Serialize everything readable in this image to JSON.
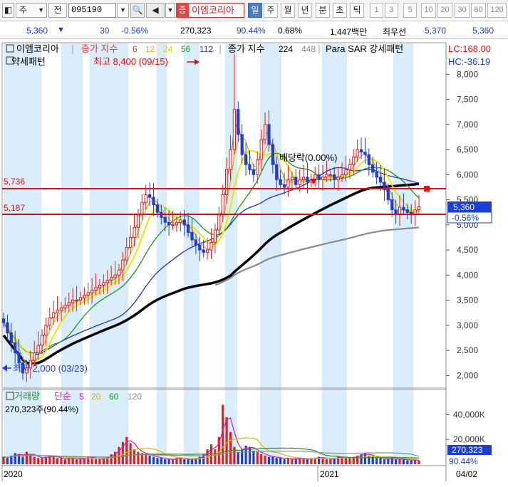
{
  "toolbar": {
    "menu_label": "주",
    "prev_label": "전",
    "code": "095190",
    "jeung_badge": "증",
    "stock_name": "이엠코리아",
    "periods": [
      "일",
      "주",
      "월",
      "년",
      "분",
      "초",
      "틱"
    ],
    "active_period": "일",
    "minute_options": [
      "1",
      "3",
      "5",
      "10",
      "20",
      "30",
      "60",
      "120"
    ]
  },
  "quote": {
    "price": "5,360",
    "change": "30",
    "change_pct": "-0.56%",
    "volume": "270,323",
    "volume_ratio": "90.44%",
    "turnover": "0.68%",
    "trade_value": "1,447백만",
    "ask_label": "최우선",
    "ask": "5,370",
    "bid": "5,360"
  },
  "price_panel": {
    "legend": {
      "name": "이엠코리아",
      "ma_title": "종가 지수",
      "ma_periods": [
        "6",
        "12",
        "24",
        "56",
        "112"
      ],
      "ma_colors": [
        "#e03a3a",
        "#e0b400",
        "#e8e800",
        "#1a9a1a",
        "#2a2ad8"
      ],
      "ma2_title": "종가 지수",
      "ma2_periods": [
        "224",
        "448"
      ],
      "ma2_colors": [
        "#000000",
        "#8a8a8a"
      ],
      "sar_title": "Para SAR 강세패턴",
      "sar_sub": "약세패턴"
    },
    "lc": "LC:168.00",
    "hc": "HC:-36.19",
    "high_annotation": "최고 8,400 (09/15)",
    "low_annotation": "최저 2,000 (03/23)",
    "dividend_label": "배당락(0.00%)",
    "hline_upper": "5,736",
    "hline_lower": "5,187",
    "current_price_tag": "5,360",
    "current_pct_tag": "-0.56%",
    "y_ticks": [
      "8,000",
      "7,500",
      "7,000",
      "6,500",
      "6,000",
      "5,500",
      "5,000",
      "4,500",
      "4,000",
      "3,500",
      "3,000",
      "2,500",
      "2,000"
    ]
  },
  "volume_panel": {
    "legend_title": "거래량",
    "ma_title": "단순",
    "ma_periods": [
      "5",
      "20",
      "60",
      "120"
    ],
    "ma_colors": [
      "#c81ec8",
      "#e0b400",
      "#1a9a1a",
      "#8a8a8a"
    ],
    "sub_label": "270,323주(90.44%)",
    "y_ticks": [
      "40,000K",
      "20,000K"
    ],
    "current_tag": "270,323",
    "current_pct": "90.44%"
  },
  "x_axis": {
    "labels": [
      "2020",
      "2021"
    ],
    "end_date": "04/02"
  },
  "colors": {
    "up": "#e02020",
    "down": "#1a3fd8",
    "stripe": "#d9ecfa",
    "hline": "#e01010",
    "axis_bg": "#ffffff"
  },
  "chart_data": {
    "type": "candlestick",
    "x_range": [
      "2020-01",
      "2021-04-02"
    ],
    "y_range": [
      1750,
      8600
    ],
    "close_series": [
      3050,
      2850,
      2650,
      2450,
      2250,
      2050,
      2150,
      2300,
      2450,
      2600,
      2800,
      3000,
      3150,
      3250,
      3300,
      3350,
      3400,
      3450,
      3500,
      3500,
      3550,
      3600,
      3650,
      3700,
      3750,
      3800,
      3850,
      3900,
      3950,
      4000,
      4100,
      4300,
      4550,
      4750,
      4950,
      5200,
      5450,
      5600,
      5550,
      5400,
      5250,
      5150,
      5050,
      5000,
      5000,
      5050,
      5100,
      5000,
      4850,
      4700,
      4600,
      4500,
      4450,
      4500,
      4650,
      4900,
      5200,
      5600,
      6100,
      6500,
      7300,
      6800,
      6400,
      6200,
      6100,
      6000,
      6300,
      6700,
      7000,
      6600,
      6200,
      5900,
      5800,
      5750,
      5900,
      5950,
      5800,
      5900,
      5950,
      5850,
      5900,
      6000,
      5900,
      5950,
      6000,
      6000,
      5900,
      5950,
      6000,
      6100,
      6200,
      6350,
      6500,
      6450,
      6400,
      6200,
      6050,
      5950,
      5850,
      5700,
      5500,
      5300,
      5200,
      5350,
      5300,
      5250,
      5200,
      5300,
      5360
    ],
    "volume_series": [
      6,
      5,
      7,
      9,
      8,
      6,
      10,
      8,
      6,
      5,
      5,
      6,
      7,
      6,
      5,
      5,
      4,
      5,
      5,
      4,
      4,
      5,
      6,
      5,
      4,
      4,
      5,
      6,
      8,
      10,
      14,
      18,
      22,
      17,
      12,
      10,
      9,
      8,
      7,
      6,
      5,
      5,
      4,
      4,
      4,
      5,
      5,
      4,
      4,
      4,
      5,
      6,
      8,
      12,
      16,
      12,
      22,
      48,
      38,
      26,
      14,
      10,
      12,
      15,
      14,
      11,
      10,
      8,
      7,
      6,
      6,
      5,
      5,
      4,
      5,
      4,
      4,
      5,
      4,
      4,
      5,
      5,
      6,
      5,
      4,
      4,
      5,
      6,
      6,
      5,
      5,
      6,
      7,
      8,
      9,
      7,
      6,
      5,
      5,
      4,
      4,
      5,
      4,
      4,
      4,
      3,
      3,
      4,
      3
    ],
    "ma_lines": [
      "MA6",
      "MA12",
      "MA24",
      "MA56",
      "MA112",
      "MA224",
      "MA448"
    ],
    "high": 8400,
    "low": 2000,
    "last": 5360,
    "volume_unit": "K"
  }
}
